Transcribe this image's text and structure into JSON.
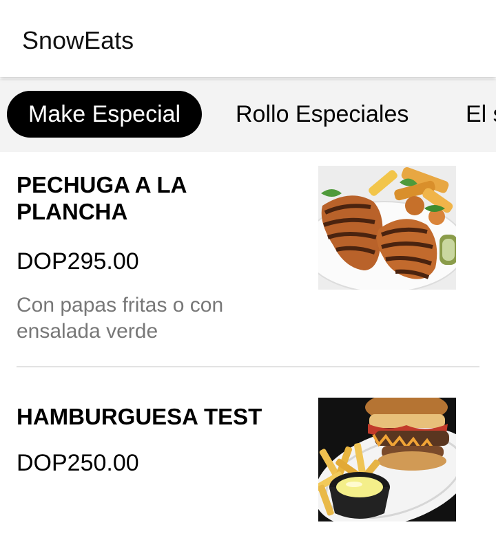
{
  "app": {
    "title": "SnowEats"
  },
  "tabs": [
    {
      "label": "Make Especial",
      "active": true
    },
    {
      "label": "Rollo Especiales",
      "active": false
    },
    {
      "label": "El s",
      "active": false
    }
  ],
  "items": [
    {
      "name": "PECHUGA A LA PLANCHA",
      "price": "DOP295.00",
      "description": "Con papas fritas o con ensalada verde",
      "image_icon": "grilled-chicken-photo"
    },
    {
      "name": "HAMBURGUESA TEST",
      "price": "DOP250.00",
      "description": "",
      "image_icon": "burger-fries-photo"
    }
  ],
  "colors": {
    "active_tab_bg": "#000000",
    "active_tab_text": "#ffffff",
    "tab_strip_bg": "#f3f3f3",
    "description_text": "#777777"
  }
}
